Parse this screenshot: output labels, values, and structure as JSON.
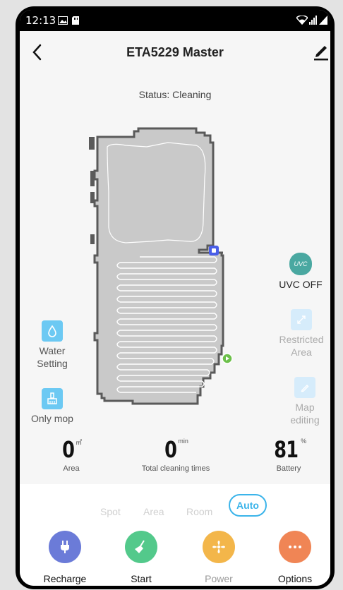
{
  "statusbar": {
    "time": "12:13"
  },
  "header": {
    "title": "ETA5229 Master"
  },
  "status_text": "Status: Cleaning",
  "left_tools": [
    {
      "label_line1": "Water",
      "label_line2": "Setting",
      "icon": "water-drop-icon"
    },
    {
      "label": "Only mop",
      "icon": "mop-brush-icon"
    }
  ],
  "right_tools": [
    {
      "label": "UVC OFF",
      "icon": "uvc-icon",
      "badge": "UVC"
    },
    {
      "label_line1": "Restricted",
      "label_line2": "Area",
      "icon": "restricted-area-icon"
    },
    {
      "label_line1": "Map",
      "label_line2": "editing",
      "icon": "map-edit-icon"
    }
  ],
  "stats": [
    {
      "value": "0",
      "unit": "㎡",
      "label": "Area"
    },
    {
      "value": "0",
      "unit": "min",
      "label": "Total cleaning times"
    },
    {
      "value": "81",
      "unit": "%",
      "label": "Battery"
    }
  ],
  "modes": {
    "spot": "Spot",
    "area": "Area",
    "room": "Room",
    "auto": "Auto",
    "selected": "Auto"
  },
  "actions": [
    {
      "label": "Recharge",
      "icon": "plug-icon",
      "color": "#6b7bd8"
    },
    {
      "label": "Start",
      "icon": "broom-icon",
      "color": "#53c98b"
    },
    {
      "label": "Power",
      "icon": "fan-icon",
      "color": "#f3b64a"
    },
    {
      "label": "Options",
      "icon": "more-icon",
      "color": "#f08555"
    }
  ],
  "colors": {
    "accent": "#3bb4ea",
    "map_fill": "#c9c9c9",
    "map_wall": "#5a5a5a",
    "uvc": "#4aa8a1"
  }
}
